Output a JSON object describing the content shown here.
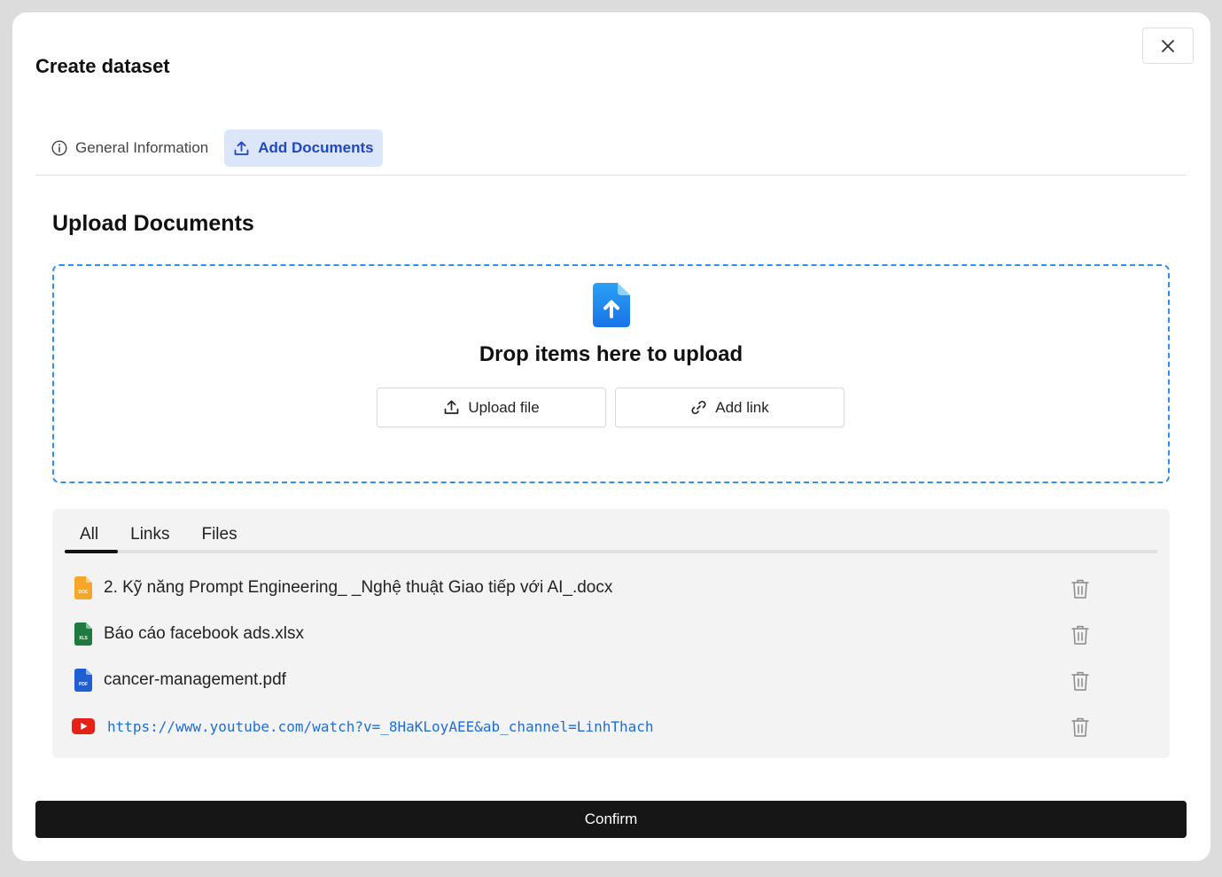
{
  "modal": {
    "title": "Create dataset",
    "tabs": [
      {
        "label": "General Information",
        "icon": "info-icon",
        "active": false
      },
      {
        "label": "Add Documents",
        "icon": "upload-icon",
        "active": true
      }
    ],
    "section_title": "Upload Documents",
    "dropzone": {
      "text": "Drop items here to upload",
      "upload_label": "Upload file",
      "link_label": "Add link"
    },
    "list_tabs": [
      "All",
      "Links",
      "Files"
    ],
    "items": [
      {
        "name": "2. Kỹ năng Prompt Engineering_ _Nghệ thuật Giao tiếp với AI_.docx",
        "type": "docx",
        "icon_label": "DOC"
      },
      {
        "name": "Báo cáo facebook ads.xlsx",
        "type": "xlsx",
        "icon_label": "XLS"
      },
      {
        "name": "cancer-management.pdf",
        "type": "pdf",
        "icon_label": "PDF"
      },
      {
        "name": "https://www.youtube.com/watch?v=_8HaKLoyAEE&ab_channel=LinhThach",
        "type": "youtube"
      }
    ],
    "confirm_label": "Confirm"
  },
  "colors": {
    "accent": "#2f8ef0",
    "tab_active_bg": "#dce6fb",
    "tab_active_text": "#1f47c6",
    "confirm_bg": "#161616",
    "doc": "#f6a72a",
    "xls": "#1f7a3f",
    "pdf": "#1f5fd1",
    "youtube": "#e62117"
  }
}
